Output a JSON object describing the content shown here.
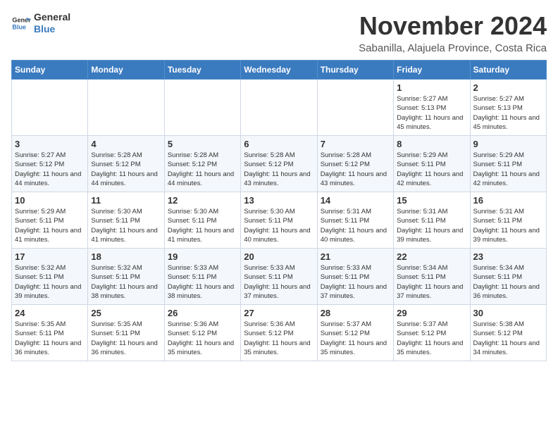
{
  "logo": {
    "line1": "General",
    "line2": "Blue"
  },
  "title": "November 2024",
  "location": "Sabanilla, Alajuela Province, Costa Rica",
  "days_of_week": [
    "Sunday",
    "Monday",
    "Tuesday",
    "Wednesday",
    "Thursday",
    "Friday",
    "Saturday"
  ],
  "weeks": [
    [
      {
        "day": "",
        "info": ""
      },
      {
        "day": "",
        "info": ""
      },
      {
        "day": "",
        "info": ""
      },
      {
        "day": "",
        "info": ""
      },
      {
        "day": "",
        "info": ""
      },
      {
        "day": "1",
        "info": "Sunrise: 5:27 AM\nSunset: 5:13 PM\nDaylight: 11 hours and 45 minutes."
      },
      {
        "day": "2",
        "info": "Sunrise: 5:27 AM\nSunset: 5:13 PM\nDaylight: 11 hours and 45 minutes."
      }
    ],
    [
      {
        "day": "3",
        "info": "Sunrise: 5:27 AM\nSunset: 5:12 PM\nDaylight: 11 hours and 44 minutes."
      },
      {
        "day": "4",
        "info": "Sunrise: 5:28 AM\nSunset: 5:12 PM\nDaylight: 11 hours and 44 minutes."
      },
      {
        "day": "5",
        "info": "Sunrise: 5:28 AM\nSunset: 5:12 PM\nDaylight: 11 hours and 44 minutes."
      },
      {
        "day": "6",
        "info": "Sunrise: 5:28 AM\nSunset: 5:12 PM\nDaylight: 11 hours and 43 minutes."
      },
      {
        "day": "7",
        "info": "Sunrise: 5:28 AM\nSunset: 5:12 PM\nDaylight: 11 hours and 43 minutes."
      },
      {
        "day": "8",
        "info": "Sunrise: 5:29 AM\nSunset: 5:11 PM\nDaylight: 11 hours and 42 minutes."
      },
      {
        "day": "9",
        "info": "Sunrise: 5:29 AM\nSunset: 5:11 PM\nDaylight: 11 hours and 42 minutes."
      }
    ],
    [
      {
        "day": "10",
        "info": "Sunrise: 5:29 AM\nSunset: 5:11 PM\nDaylight: 11 hours and 41 minutes."
      },
      {
        "day": "11",
        "info": "Sunrise: 5:30 AM\nSunset: 5:11 PM\nDaylight: 11 hours and 41 minutes."
      },
      {
        "day": "12",
        "info": "Sunrise: 5:30 AM\nSunset: 5:11 PM\nDaylight: 11 hours and 41 minutes."
      },
      {
        "day": "13",
        "info": "Sunrise: 5:30 AM\nSunset: 5:11 PM\nDaylight: 11 hours and 40 minutes."
      },
      {
        "day": "14",
        "info": "Sunrise: 5:31 AM\nSunset: 5:11 PM\nDaylight: 11 hours and 40 minutes."
      },
      {
        "day": "15",
        "info": "Sunrise: 5:31 AM\nSunset: 5:11 PM\nDaylight: 11 hours and 39 minutes."
      },
      {
        "day": "16",
        "info": "Sunrise: 5:31 AM\nSunset: 5:11 PM\nDaylight: 11 hours and 39 minutes."
      }
    ],
    [
      {
        "day": "17",
        "info": "Sunrise: 5:32 AM\nSunset: 5:11 PM\nDaylight: 11 hours and 39 minutes."
      },
      {
        "day": "18",
        "info": "Sunrise: 5:32 AM\nSunset: 5:11 PM\nDaylight: 11 hours and 38 minutes."
      },
      {
        "day": "19",
        "info": "Sunrise: 5:33 AM\nSunset: 5:11 PM\nDaylight: 11 hours and 38 minutes."
      },
      {
        "day": "20",
        "info": "Sunrise: 5:33 AM\nSunset: 5:11 PM\nDaylight: 11 hours and 37 minutes."
      },
      {
        "day": "21",
        "info": "Sunrise: 5:33 AM\nSunset: 5:11 PM\nDaylight: 11 hours and 37 minutes."
      },
      {
        "day": "22",
        "info": "Sunrise: 5:34 AM\nSunset: 5:11 PM\nDaylight: 11 hours and 37 minutes."
      },
      {
        "day": "23",
        "info": "Sunrise: 5:34 AM\nSunset: 5:11 PM\nDaylight: 11 hours and 36 minutes."
      }
    ],
    [
      {
        "day": "24",
        "info": "Sunrise: 5:35 AM\nSunset: 5:11 PM\nDaylight: 11 hours and 36 minutes."
      },
      {
        "day": "25",
        "info": "Sunrise: 5:35 AM\nSunset: 5:11 PM\nDaylight: 11 hours and 36 minutes."
      },
      {
        "day": "26",
        "info": "Sunrise: 5:36 AM\nSunset: 5:12 PM\nDaylight: 11 hours and 35 minutes."
      },
      {
        "day": "27",
        "info": "Sunrise: 5:36 AM\nSunset: 5:12 PM\nDaylight: 11 hours and 35 minutes."
      },
      {
        "day": "28",
        "info": "Sunrise: 5:37 AM\nSunset: 5:12 PM\nDaylight: 11 hours and 35 minutes."
      },
      {
        "day": "29",
        "info": "Sunrise: 5:37 AM\nSunset: 5:12 PM\nDaylight: 11 hours and 35 minutes."
      },
      {
        "day": "30",
        "info": "Sunrise: 5:38 AM\nSunset: 5:12 PM\nDaylight: 11 hours and 34 minutes."
      }
    ]
  ]
}
